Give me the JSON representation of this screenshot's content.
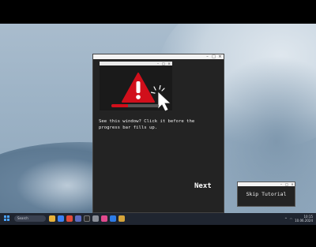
{
  "tutorial": {
    "instruction": "See this window? Click it before the progress bar fills up.",
    "next_label": "Next",
    "progress_fraction": 0.35,
    "progress_color": "#d10f1b",
    "warning_color": "#d10f1b",
    "titlebar_controls": {
      "minimize": "–",
      "maximize": "□",
      "close": "×"
    }
  },
  "skip": {
    "label": "Skip Tutorial",
    "titlebar_controls": {
      "minimize": "–",
      "maximize": "□",
      "close": "×"
    }
  },
  "taskbar": {
    "search_placeholder": "Search",
    "time": "10:15",
    "date": "10.06.2024",
    "app_icons": [
      "file-explorer-icon",
      "store-icon",
      "browser-icon",
      "mail-icon",
      "terminal-icon",
      "settings-icon",
      "media-icon",
      "vscode-icon",
      "folder-icon"
    ]
  }
}
